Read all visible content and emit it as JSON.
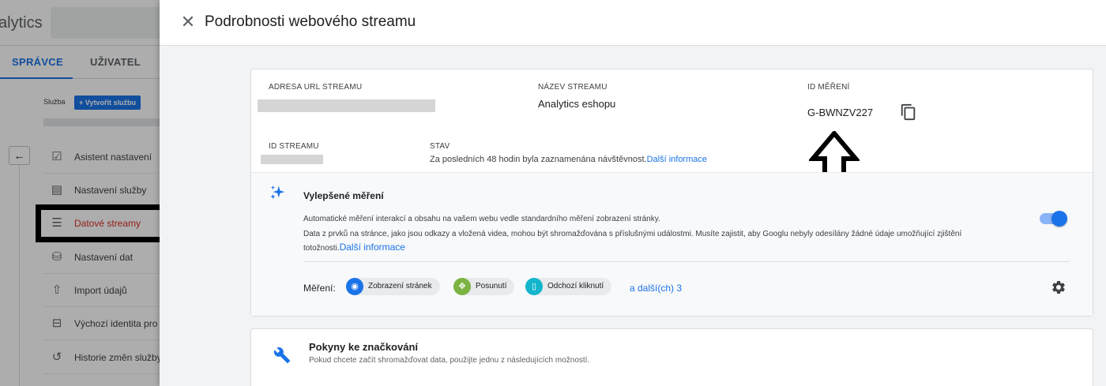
{
  "background_app": {
    "app_name_fragment": "alytics",
    "tabs": [
      {
        "label": "SPRÁVCE",
        "active": true
      },
      {
        "label": "UŽIVATEL",
        "active": false
      }
    ],
    "property_label": "Služba",
    "create_property_button": "Vytvořit službu",
    "back_icon": "arrow-left-icon",
    "nav_items": [
      {
        "label": "Asistent nastavení",
        "icon": "clipboard-check-icon"
      },
      {
        "label": "Nastavení služby",
        "icon": "layout-icon"
      },
      {
        "label": "Datové streamy",
        "icon": "data-streams-icon",
        "highlighted": true
      },
      {
        "label": "Nastavení dat",
        "icon": "database-icon"
      },
      {
        "label": "Import údajů",
        "icon": "upload-icon"
      },
      {
        "label": "Výchozí identita pro p",
        "icon": "identity-icon"
      },
      {
        "label": "Historie změn služby",
        "icon": "history-icon"
      }
    ]
  },
  "drawer": {
    "close_icon": "close-icon",
    "title": "Podrobnosti webového streamu",
    "stream_details": {
      "url_label": "ADRESA URL STREAMU",
      "name_label": "NÁZEV STREAMU",
      "name_value": "Analytics eshopu",
      "measurement_id_label": "ID MĚŘENÍ",
      "measurement_id_value": "G-BWNZV227",
      "copy_icon": "copy-icon",
      "stream_id_label": "ID STREAMU",
      "status_label": "STAV",
      "status_text": "Za posledních 48 hodin byla zaznamenána návštěvnost.",
      "status_link": "Další informace"
    },
    "enhanced_measurement": {
      "icon": "sparkle-icon",
      "title": "Vylepšené měření",
      "description_1": "Automatické měření interakcí a obsahu na vašem webu vedle standardního měření zobrazení stránky.",
      "description_2": "Data z prvků na stránce, jako jsou odkazy a vložená videa, mohou být shromažďována s příslušnými událostmi. Musíte zajistit, aby Googlu nebyly odesílány žádné údaje umožňující zjištění totožnosti.",
      "link": "Další informace",
      "toggle_on": true,
      "measures_label": "Měření:",
      "chips": [
        {
          "label": "Zobrazení stránek",
          "icon": "eye-icon"
        },
        {
          "label": "Posunutí",
          "icon": "scroll-icon"
        },
        {
          "label": "Odchozí kliknutí",
          "icon": "mouse-icon"
        }
      ],
      "more_link": "a další(ch) 3",
      "settings_icon": "gear-icon"
    },
    "tagging": {
      "icon": "wrench-icon",
      "title": "Pokyny ke značkování",
      "description": "Pokud chcete začít shromažďovat data, použijte jednu z následujících možností."
    }
  },
  "colors": {
    "accent": "#1a73e8",
    "active_nav_text": "#d93025",
    "annotation": "#000000"
  }
}
